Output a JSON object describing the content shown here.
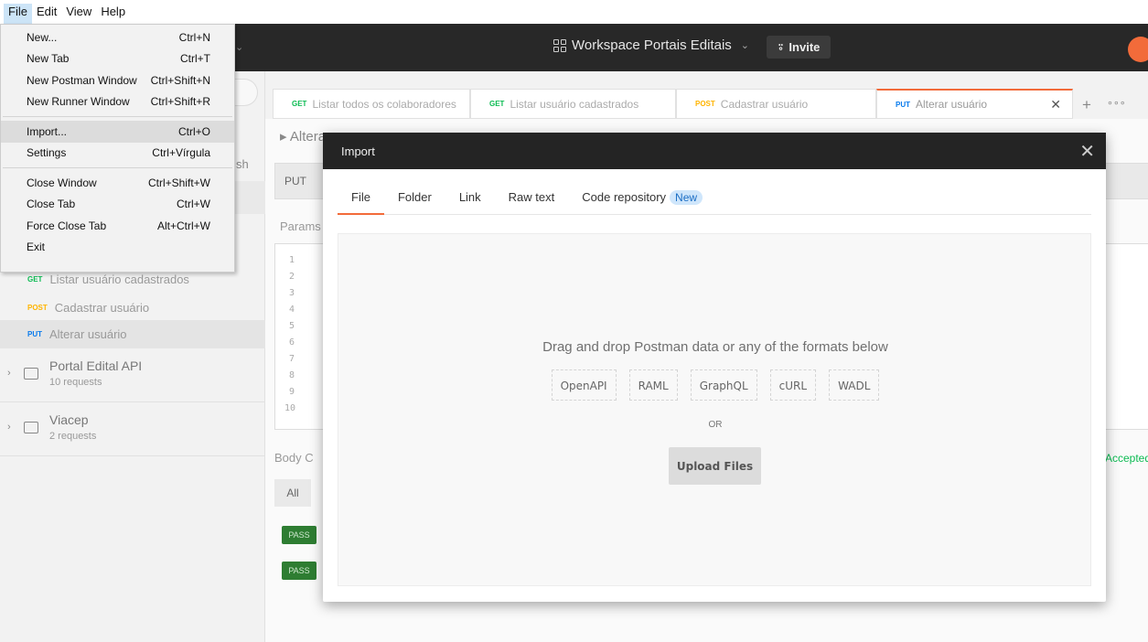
{
  "menubar": {
    "items": [
      "File",
      "Edit",
      "View",
      "Help"
    ]
  },
  "header": {
    "workspace": "Workspace Portais Editais",
    "invite_label": "Invite"
  },
  "sidebar": {
    "partial_label": "sh",
    "requests": [
      {
        "method": "GET",
        "name": "Listar usuário cadastrados"
      },
      {
        "method": "POST",
        "name": "Cadastrar usuário"
      },
      {
        "method": "PUT",
        "name": "Alterar usuário"
      }
    ],
    "folders": [
      {
        "name": "Portal Edital API",
        "sub": "10 requests"
      },
      {
        "name": "Viacep",
        "sub": "2 requests"
      }
    ]
  },
  "tabs": [
    {
      "method": "GET",
      "name": "Listar todos os colaboradores"
    },
    {
      "method": "GET",
      "name": "Listar usuário cadastrados"
    },
    {
      "method": "POST",
      "name": "Cadastrar usuário"
    },
    {
      "method": "PUT",
      "name": "Alterar usuário"
    }
  ],
  "main": {
    "title": "▸ Altera",
    "method": "PUT",
    "params": "Params",
    "line_numbers": [
      "1",
      "2",
      "3",
      "4",
      "5",
      "6",
      "7",
      "8",
      "9",
      "10"
    ],
    "body_label": "Body  C",
    "all_label": "All",
    "pass_label": "PASS",
    "accepted_label": "Accepted"
  },
  "file_menu": {
    "groups": [
      [
        {
          "label": "New...",
          "shortcut": "Ctrl+N"
        },
        {
          "label": "New Tab",
          "shortcut": "Ctrl+T"
        },
        {
          "label": "New Postman Window",
          "shortcut": "Ctrl+Shift+N"
        },
        {
          "label": "New Runner Window",
          "shortcut": "Ctrl+Shift+R"
        }
      ],
      [
        {
          "label": "Import...",
          "shortcut": "Ctrl+O",
          "highlighted": true
        },
        {
          "label": "Settings",
          "shortcut": "Ctrl+Vírgula"
        }
      ],
      [
        {
          "label": "Close Window",
          "shortcut": "Ctrl+Shift+W"
        },
        {
          "label": "Close Tab",
          "shortcut": "Ctrl+W"
        },
        {
          "label": "Force Close Tab",
          "shortcut": "Alt+Ctrl+W"
        },
        {
          "label": "Exit",
          "shortcut": ""
        }
      ]
    ]
  },
  "import_modal": {
    "title": "Import",
    "tabs": [
      "File",
      "Folder",
      "Link",
      "Raw text",
      "Code repository"
    ],
    "new_badge": "New",
    "drop_text": "Drag and drop Postman data or any of the formats below",
    "formats": [
      "OpenAPI",
      "RAML",
      "GraphQL",
      "cURL",
      "WADL"
    ],
    "or_text": "OR",
    "upload_label": "Upload Files"
  },
  "colors": {
    "accent": "#f26b3a",
    "get": "#0cbb52",
    "post": "#ffb400",
    "put": "#097bed",
    "header": "#282828"
  }
}
